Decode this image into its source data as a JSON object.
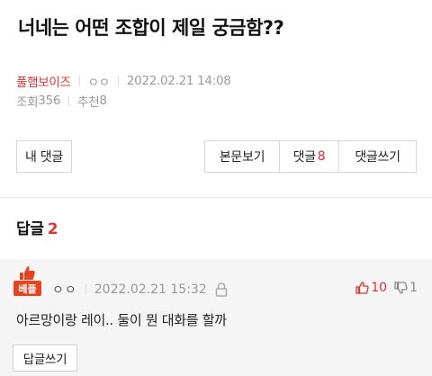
{
  "post": {
    "title": "너네는 어떤 조합이 제일 궁금함??",
    "author": "풀햄보이즈",
    "author_tag": "ㅇㅇ",
    "datetime": "2022.02.21 14:08",
    "views_label": "조회",
    "views": "356",
    "recommend_label": "추천",
    "recommend": "8"
  },
  "actions": {
    "my_comments": "내 댓글",
    "view_body": "본문보기",
    "comments_label": "댓글",
    "comments_count": "8",
    "write_comment": "댓글쓰기"
  },
  "replies": {
    "heading": "답글",
    "count": "2"
  },
  "reply": {
    "badge": "베플",
    "nickname": "ㅇㅇ",
    "datetime": "2022.02.21 15:32",
    "upvotes": "10",
    "downvotes": "1",
    "text": "아르망이랑 레이.. 둘이 뭔 대화를 할까",
    "reply_button": "답글쓰기"
  },
  "colors": {
    "accent": "#d33",
    "badge": "#e8431f",
    "reply_bg": "#f5f5f5"
  }
}
